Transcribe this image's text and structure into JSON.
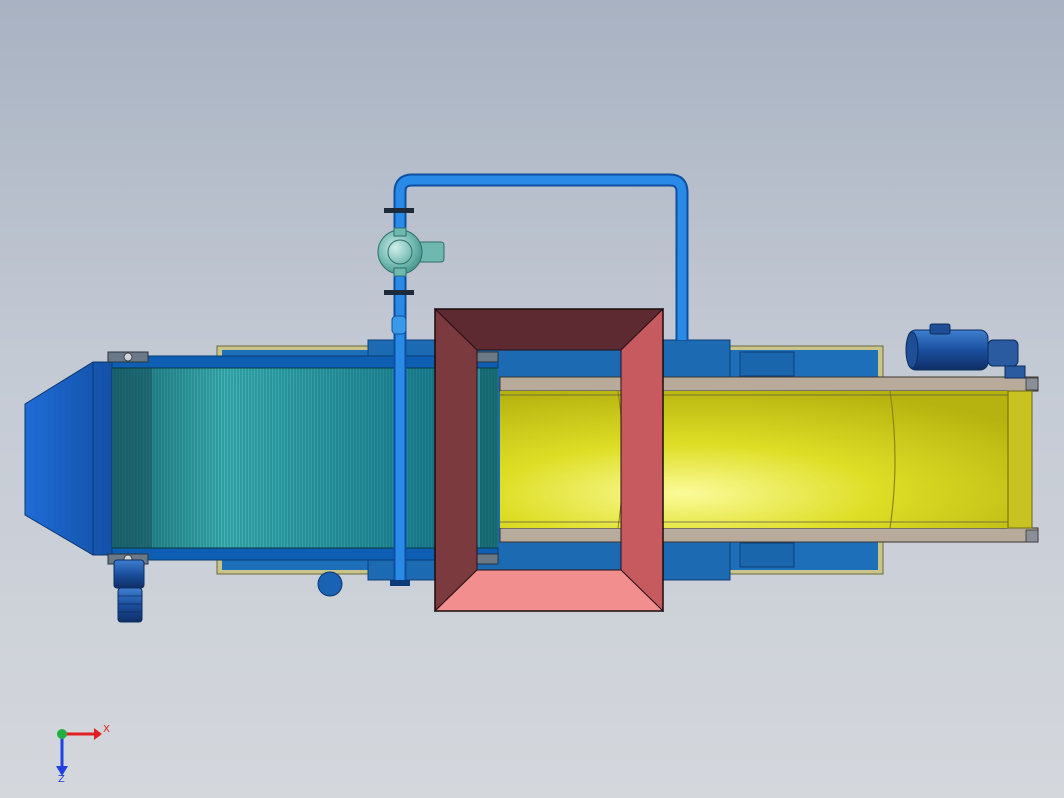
{
  "viewport": {
    "background_top": "#a8b2c2",
    "background_bottom": "#d4d7dc"
  },
  "model": {
    "colors": {
      "frame_blue": "#1d6fc8",
      "hood_blue": "#1e64c8",
      "mesh_teal": "#2fa6b0",
      "belt_yellow": "#d7d71a",
      "hopper_outer": "#b85a5a",
      "hopper_top": "#5c2a30",
      "hopper_bottom": "#f08c8c",
      "rail_gray": "#b7aa9c",
      "pipe_blue": "#1e80e0",
      "pump_teal": "#5fb0a8",
      "motor_blue": "#1a55a8"
    }
  },
  "triad": {
    "x_label": "X",
    "z_label": "Z",
    "x_color": "#e02020",
    "y_color": "#20b040",
    "z_color": "#2040e0"
  }
}
